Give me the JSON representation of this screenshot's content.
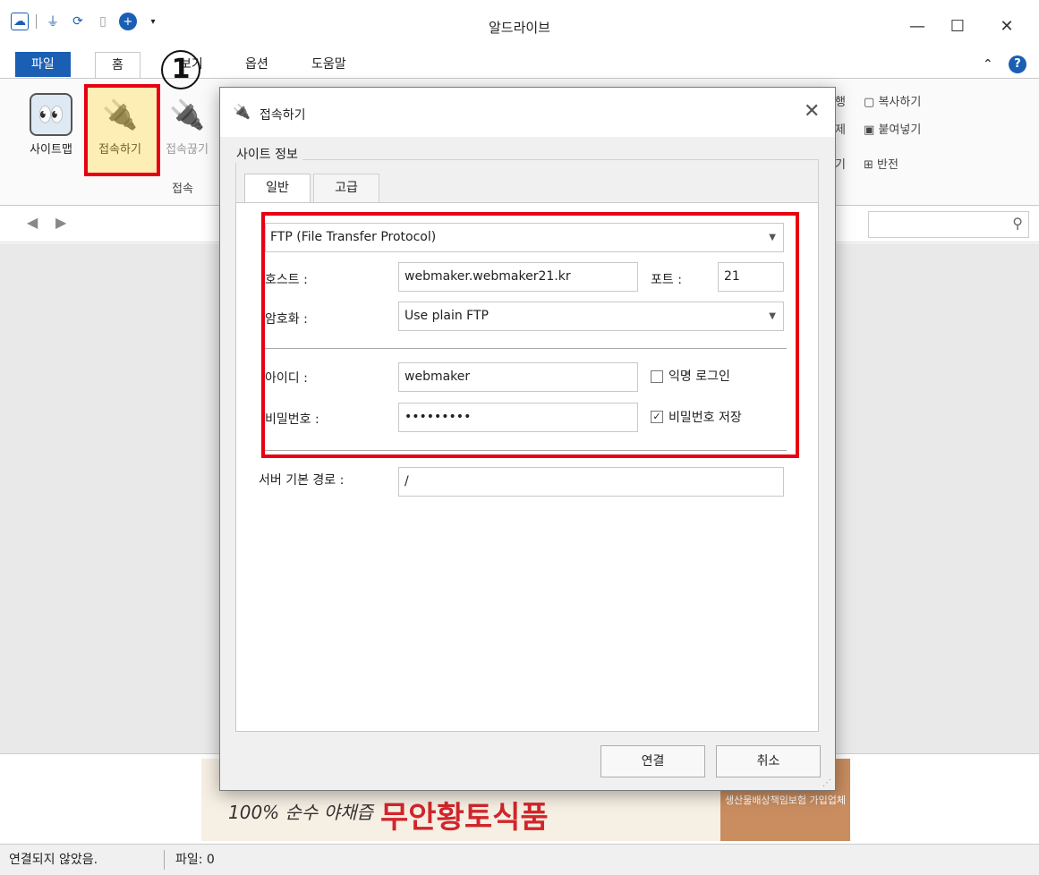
{
  "window": {
    "title": "알드라이브"
  },
  "ribbon_tabs": [
    "파일",
    "홈",
    "보기",
    "옵션",
    "도움말"
  ],
  "ribbon": {
    "sitemap": "사이트맵",
    "connect": "접속하기",
    "disconnect": "접속끊기",
    "group_label": "접속",
    "copy": "복사하기",
    "paste": "붙여넣기",
    "invert": "반전",
    "run_partial": "행",
    "delete_partial": "제",
    "select_partial": "기"
  },
  "callout_number": "1",
  "dialog": {
    "title": "접속하기",
    "group_label": "사이트 정보",
    "tabs": [
      "일반",
      "고급"
    ],
    "protocol": "FTP (File Transfer Protocol)",
    "host_label": "호스트 :",
    "host_value": "webmaker.webmaker21.kr",
    "port_label": "포트 :",
    "port_value": "21",
    "encryption_label": "암호화 :",
    "encryption_value": "Use plain FTP",
    "id_label": "아이디 :",
    "id_value": "webmaker",
    "anonymous_label": "익명 로그인",
    "anonymous_checked": false,
    "password_label": "비밀번호 :",
    "password_value": "•••••••••",
    "save_password_label": "비밀번호 저장",
    "save_password_checked": true,
    "server_path_label": "서버 기본 경로 :",
    "server_path_value": "/",
    "connect_button": "연결",
    "cancel_button": "취소"
  },
  "ad": {
    "tagline": "100% 순수 야채즙",
    "brand": "무안황토식품",
    "side": "생산물배상책임보험 가입업체"
  },
  "status": {
    "connection": "연결되지 않았음.",
    "files": "파일: 0"
  }
}
